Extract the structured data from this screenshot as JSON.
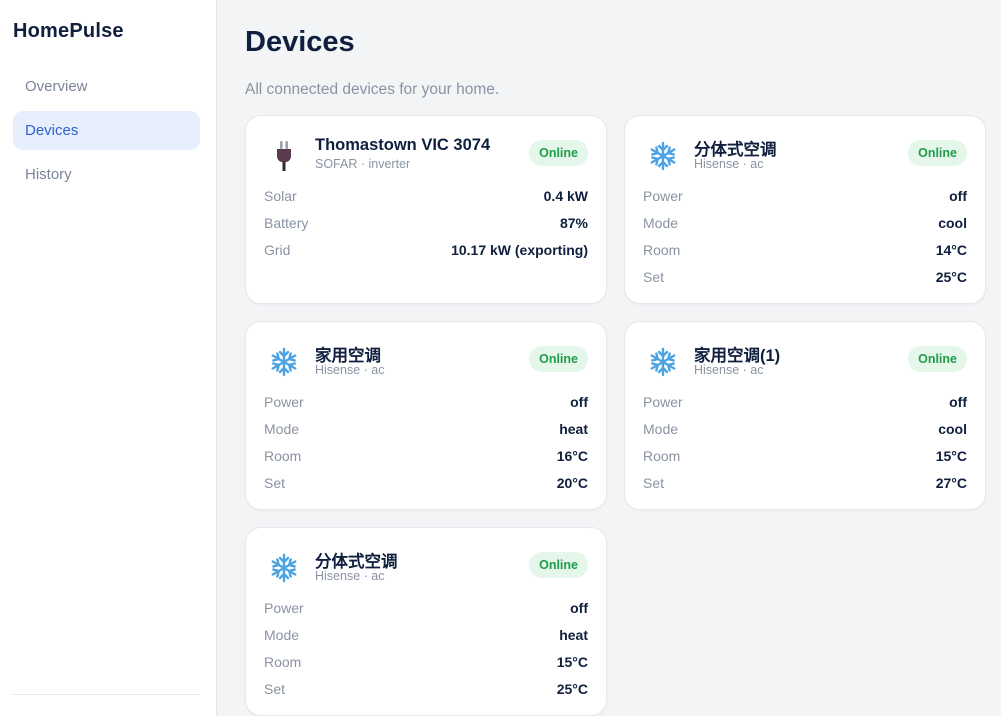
{
  "app": {
    "name": "HomePulse"
  },
  "nav": {
    "items": [
      {
        "label": "Overview",
        "active": false
      },
      {
        "label": "Devices",
        "active": true
      },
      {
        "label": "History",
        "active": false
      }
    ]
  },
  "page": {
    "title": "Devices",
    "subtitle": "All connected devices for your home."
  },
  "colors": {
    "accent": "#2f5fd0",
    "online_bg": "#e5f6ea",
    "online_text": "#1f9d4a",
    "ac_icon": "#4ba3e3"
  },
  "devices": [
    {
      "icon": "plug-icon",
      "name": "Thomastown VIC 3074",
      "meta": "SOFAR · inverter",
      "status": "Online",
      "rows": [
        {
          "label": "Solar",
          "value": "0.4 kW"
        },
        {
          "label": "Battery",
          "value": "87%"
        },
        {
          "label": "Grid",
          "value": "10.17 kW (exporting)"
        }
      ]
    },
    {
      "icon": "snowflake-icon",
      "name": "分体式空调",
      "meta": "Hisense · ac",
      "status": "Online",
      "rows": [
        {
          "label": "Power",
          "value": "off"
        },
        {
          "label": "Mode",
          "value": "cool"
        },
        {
          "label": "Room",
          "value": "14°C"
        },
        {
          "label": "Set",
          "value": "25°C"
        }
      ]
    },
    {
      "icon": "snowflake-icon",
      "name": "家用空调",
      "meta": "Hisense · ac",
      "status": "Online",
      "rows": [
        {
          "label": "Power",
          "value": "off"
        },
        {
          "label": "Mode",
          "value": "heat"
        },
        {
          "label": "Room",
          "value": "16°C"
        },
        {
          "label": "Set",
          "value": "20°C"
        }
      ]
    },
    {
      "icon": "snowflake-icon",
      "name": "家用空调(1)",
      "meta": "Hisense · ac",
      "status": "Online",
      "rows": [
        {
          "label": "Power",
          "value": "off"
        },
        {
          "label": "Mode",
          "value": "cool"
        },
        {
          "label": "Room",
          "value": "15°C"
        },
        {
          "label": "Set",
          "value": "27°C"
        }
      ]
    },
    {
      "icon": "snowflake-icon",
      "name": "分体式空调",
      "meta": "Hisense · ac",
      "status": "Online",
      "rows": [
        {
          "label": "Power",
          "value": "off"
        },
        {
          "label": "Mode",
          "value": "heat"
        },
        {
          "label": "Room",
          "value": "15°C"
        },
        {
          "label": "Set",
          "value": "25°C"
        }
      ]
    }
  ]
}
